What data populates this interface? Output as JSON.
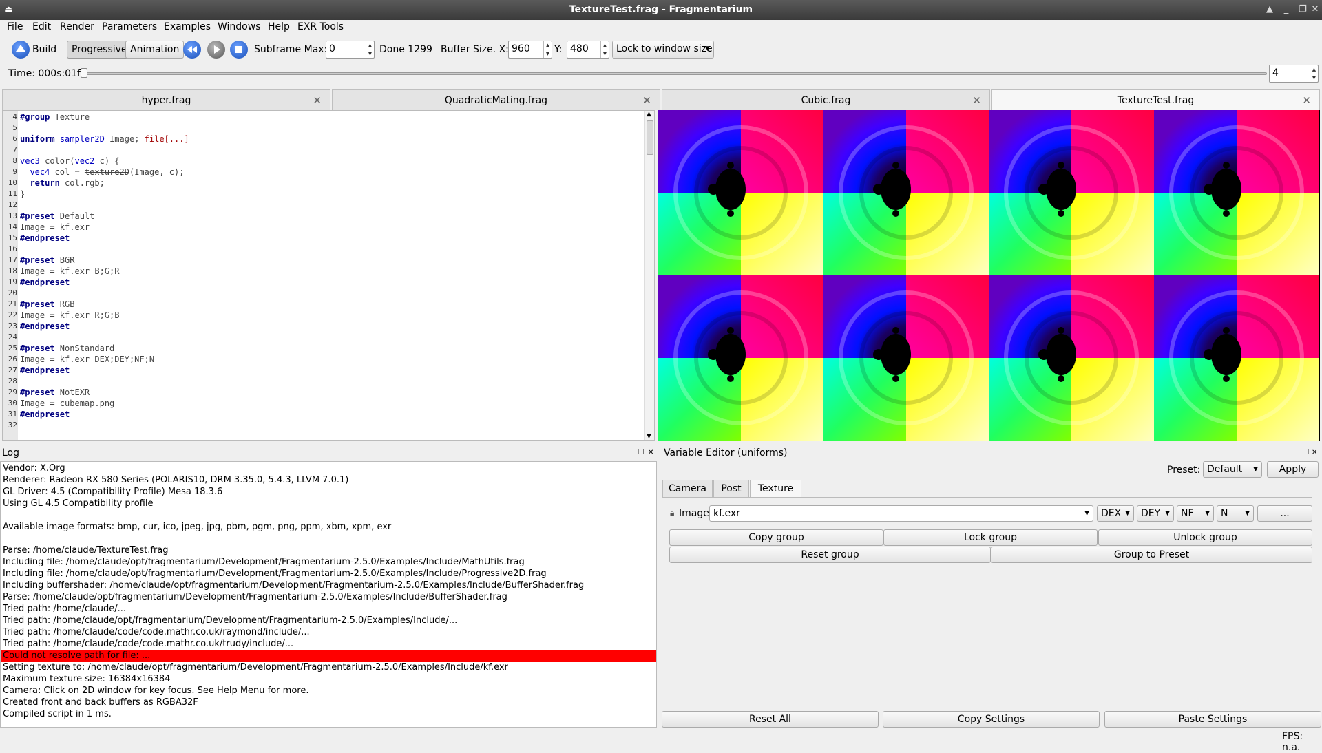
{
  "window": {
    "title": "TextureTest.frag - Fragmentarium"
  },
  "menu": [
    "File",
    "Edit",
    "Render",
    "Parameters",
    "Examples",
    "Windows",
    "Help",
    "EXR Tools"
  ],
  "toolbar": {
    "build": "Build",
    "progressive": "Progressive",
    "animation": "Animation",
    "subframe_label": "Subframe Max:",
    "subframe_value": "0",
    "done": "Done 1299",
    "buffer_label": "Buffer Size. X:",
    "buffer_x": "960",
    "y_label": "Y:",
    "buffer_y": "480",
    "lock_option": "Lock to window size"
  },
  "timebar": {
    "time": "Time: 000s:01f",
    "value": "4"
  },
  "tabs": [
    "hyper.frag",
    "QuadraticMating.frag",
    "Cubic.frag",
    "TextureTest.frag"
  ],
  "code_lines": [
    {
      "n": "4",
      "t": "#group Texture"
    },
    {
      "n": "5",
      "t": ""
    },
    {
      "n": "6",
      "t": "uniform sampler2D Image; file[...]"
    },
    {
      "n": "7",
      "t": ""
    },
    {
      "n": "8",
      "t": "vec3 color(vec2 c) {"
    },
    {
      "n": "9",
      "t": "  vec4 col = texture2D(Image, c);"
    },
    {
      "n": "10",
      "t": "  return col.rgb;"
    },
    {
      "n": "11",
      "t": "}"
    },
    {
      "n": "12",
      "t": ""
    },
    {
      "n": "13",
      "t": "#preset Default"
    },
    {
      "n": "14",
      "t": "Image = kf.exr"
    },
    {
      "n": "15",
      "t": "#endpreset"
    },
    {
      "n": "16",
      "t": ""
    },
    {
      "n": "17",
      "t": "#preset BGR"
    },
    {
      "n": "18",
      "t": "Image = kf.exr B;G;R"
    },
    {
      "n": "19",
      "t": "#endpreset"
    },
    {
      "n": "20",
      "t": ""
    },
    {
      "n": "21",
      "t": "#preset RGB"
    },
    {
      "n": "22",
      "t": "Image = kf.exr R;G;B"
    },
    {
      "n": "23",
      "t": "#endpreset"
    },
    {
      "n": "24",
      "t": ""
    },
    {
      "n": "25",
      "t": "#preset NonStandard"
    },
    {
      "n": "26",
      "t": "Image = kf.exr DEX;DEY;NF;N"
    },
    {
      "n": "27",
      "t": "#endpreset"
    },
    {
      "n": "28",
      "t": ""
    },
    {
      "n": "29",
      "t": "#preset NotEXR"
    },
    {
      "n": "30",
      "t": "Image = cubemap.png"
    },
    {
      "n": "31",
      "t": "#endpreset"
    },
    {
      "n": "32",
      "t": ""
    }
  ],
  "log": {
    "title": "Log",
    "lines": [
      "Vendor: X.Org",
      "Renderer: Radeon RX 580 Series (POLARIS10, DRM 3.35.0, 5.4.3, LLVM 7.0.1)",
      "GL Driver: 4.5 (Compatibility Profile) Mesa 18.3.6",
      "Using GL 4.5 Compatibility profile",
      "",
      "Available image formats: bmp, cur, ico, jpeg, jpg, pbm, pgm, png, ppm, xbm, xpm, exr",
      "",
      "Parse: /home/claude/TextureTest.frag",
      "Including file: /home/claude/opt/fragmentarium/Development/Fragmentarium-2.5.0/Examples/Include/MathUtils.frag",
      "Including file: /home/claude/opt/fragmentarium/Development/Fragmentarium-2.5.0/Examples/Include/Progressive2D.frag",
      "Including buffershader: /home/claude/opt/fragmentarium/Development/Fragmentarium-2.5.0/Examples/Include/BufferShader.frag",
      "Parse: /home/claude/opt/fragmentarium/Development/Fragmentarium-2.5.0/Examples/Include/BufferShader.frag",
      "Tried path: /home/claude/...",
      "Tried path: /home/claude/opt/fragmentarium/Development/Fragmentarium-2.5.0/Examples/Include/...",
      "Tried path: /home/claude/code/code.mathr.co.uk/raymond/include/...",
      "Tried path: /home/claude/code/code.mathr.co.uk/trudy/include/...",
      "Could not resolve path for file: ...",
      "Setting texture to: /home/claude/opt/fragmentarium/Development/Fragmentarium-2.5.0/Examples/Include/kf.exr",
      "Maximum texture size: 16384x16384",
      "Camera: Click on 2D window for key focus. See Help Menu for more.",
      "Created front and back buffers as RGBA32F",
      "Compiled script in 1 ms."
    ],
    "error_index": 16
  },
  "variable_editor": {
    "title": "Variable Editor (uniforms)",
    "preset_label": "Preset:",
    "preset_value": "Default",
    "apply": "Apply",
    "tabs": [
      "Camera",
      "Post",
      "Texture"
    ],
    "image_label": "Image",
    "image_value": "kf.exr",
    "channels": [
      "DEX",
      "DEY",
      "NF",
      "N"
    ],
    "browse": "...",
    "copy_group": "Copy group",
    "lock_group": "Lock group",
    "unlock_group": "Unlock group",
    "reset_group": "Reset group",
    "group_to_preset": "Group to Preset",
    "reset_all": "Reset All",
    "copy_settings": "Copy Settings",
    "paste_settings": "Paste Settings"
  },
  "status": {
    "fps": "FPS: n.a."
  }
}
